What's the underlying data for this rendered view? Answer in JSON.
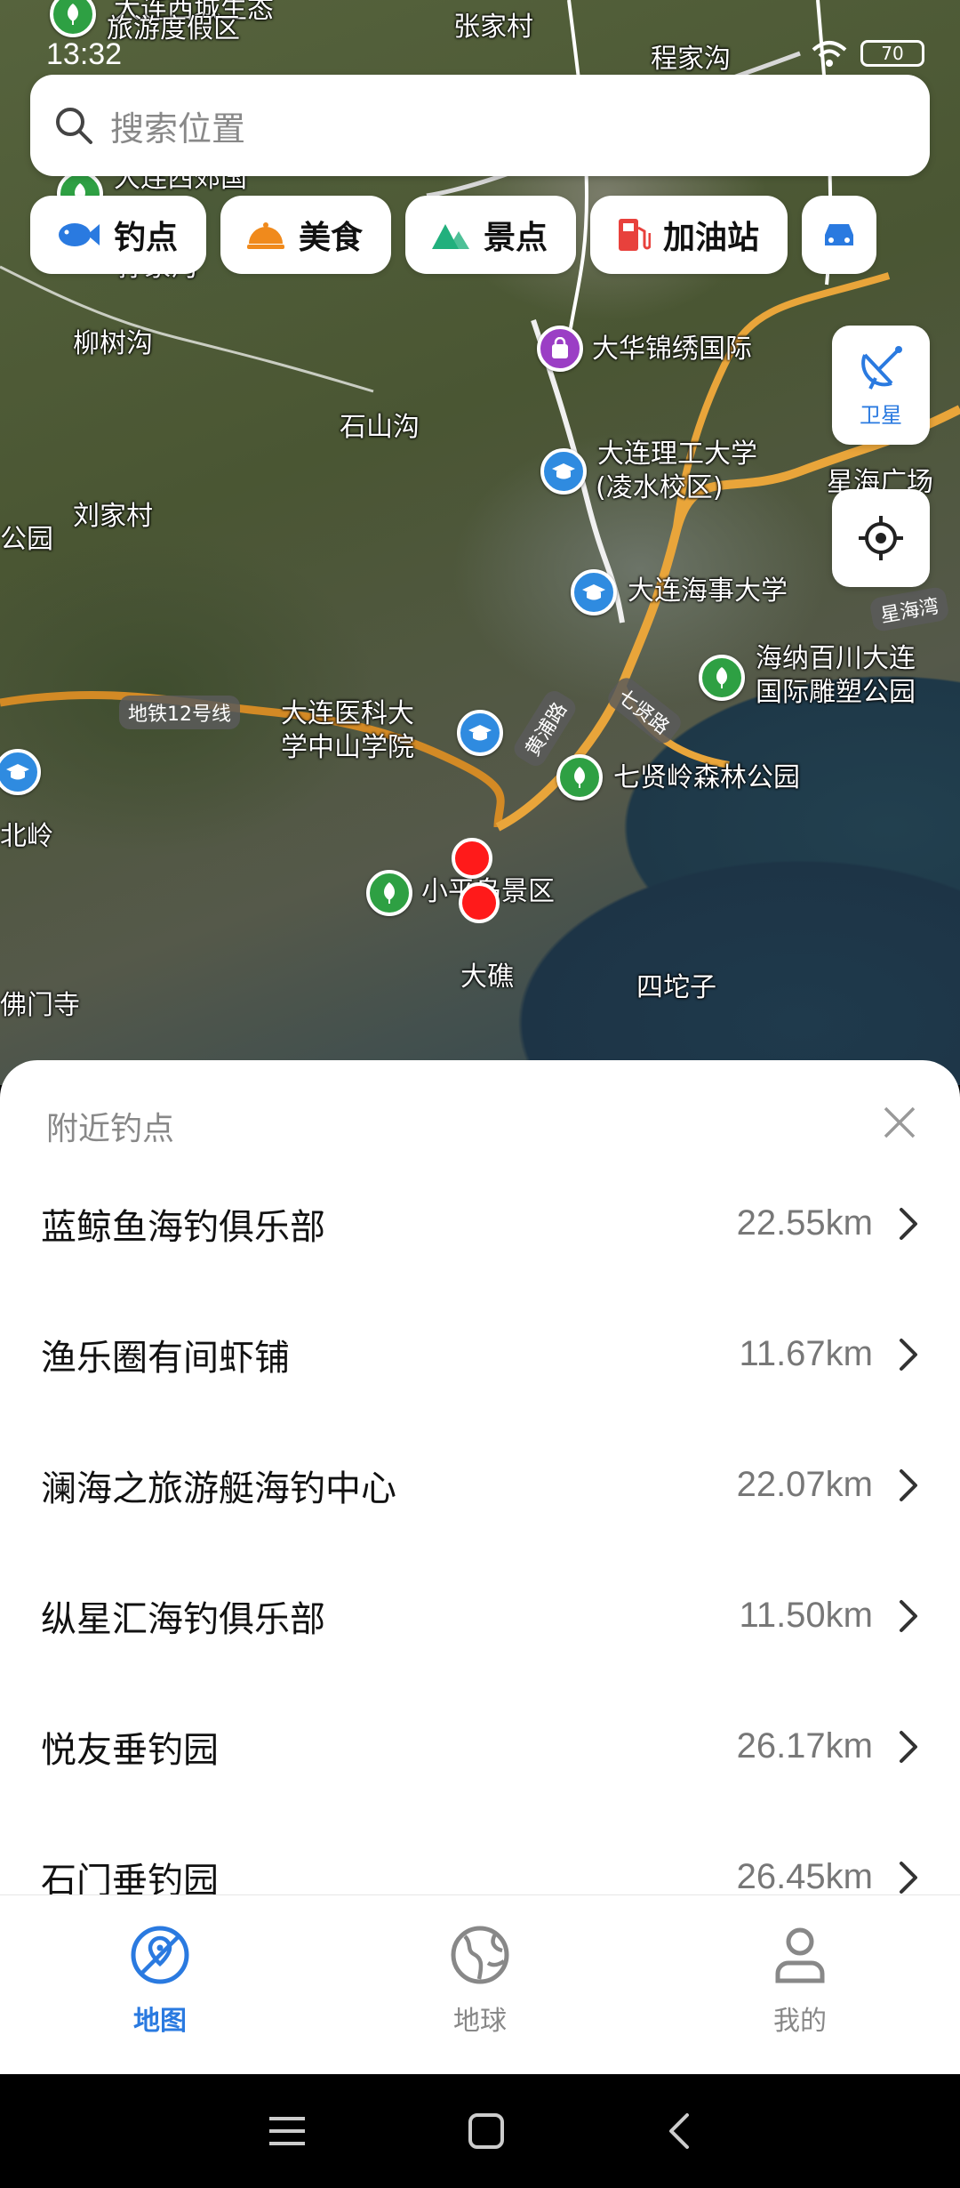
{
  "status_bar": {
    "time": "13:32",
    "battery": "70"
  },
  "search": {
    "placeholder": "搜索位置"
  },
  "chips": [
    {
      "label": "钓点",
      "icon": "fish-icon",
      "color": "#2a7ae0"
    },
    {
      "label": "美食",
      "icon": "food-bell-icon",
      "color": "#f08a1c"
    },
    {
      "label": "景点",
      "icon": "mountain-icon",
      "color": "#22b07d"
    },
    {
      "label": "加油站",
      "icon": "gas-pump-icon",
      "color": "#e8413c"
    }
  ],
  "map_controls": {
    "satellite_label": "卫星"
  },
  "map_labels": {
    "l1": "大连西城生态",
    "l2": "旅游度假区",
    "l3": "张家村",
    "l4": "程家沟",
    "l5": "大连西郊国",
    "l6": "孙家沟",
    "l7": "柳树沟",
    "l8": "大华锦绣国际",
    "l9": "石山沟",
    "l10": "大连理工大学",
    "l11": "(凌水校区)",
    "l12": "星海广场",
    "l13": "刘家村",
    "l14": "公园",
    "l15": "大连海事大学",
    "l16": "海纳百川大连",
    "l17": "国际雕塑公园",
    "l18": "大连医科大",
    "l19": "学中山学院",
    "l20": "七贤岭森林公园",
    "l21": "北岭",
    "l22": "小平岛景区",
    "l23": "大礁",
    "l24": "四坨子",
    "l25": "佛门寺",
    "road1": "地铁12号线",
    "road2": "七贤路",
    "road3": "黄浦路",
    "road4": "星海湾"
  },
  "sheet": {
    "title": "附近钓点",
    "items": [
      {
        "name": "蓝鲸鱼海钓俱乐部",
        "distance": "22.55km"
      },
      {
        "name": "渔乐圈有间虾铺",
        "distance": "11.67km"
      },
      {
        "name": "澜海之旅游艇海钓中心",
        "distance": "22.07km"
      },
      {
        "name": "纵星汇海钓俱乐部",
        "distance": "11.50km"
      },
      {
        "name": "悦友垂钓园",
        "distance": "26.17km"
      },
      {
        "name": "石门垂钓园",
        "distance": "26.45km"
      }
    ]
  },
  "tabs": [
    {
      "label": "地图",
      "active": true
    },
    {
      "label": "地球",
      "active": false
    },
    {
      "label": "我的",
      "active": false
    }
  ],
  "colors": {
    "accent": "#2a7ae0",
    "pin": "#ff1a1a"
  }
}
